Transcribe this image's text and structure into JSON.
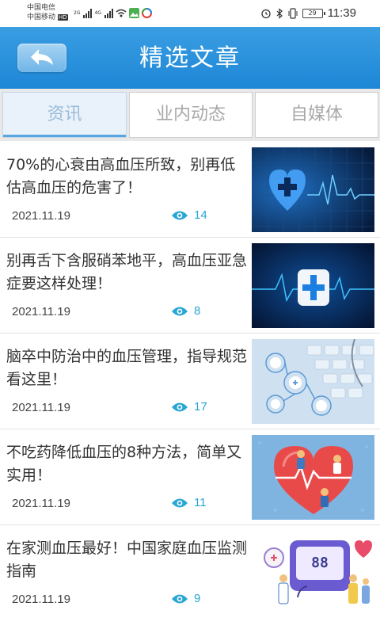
{
  "status_bar": {
    "carrier_line1": "中国电信",
    "carrier_line2": "中国移动",
    "hd_badge": "HD",
    "net_type_1": "2G",
    "net_type_2": "4G",
    "battery": "29",
    "time": "11:39"
  },
  "header": {
    "title": "精选文章",
    "back_icon": "back-arrow-icon"
  },
  "tabs": [
    {
      "label": "资讯",
      "active": true
    },
    {
      "label": "业内动态",
      "active": false
    },
    {
      "label": "自媒体",
      "active": false
    }
  ],
  "articles": [
    {
      "title": "70%的心衰由高血压所致，别再低估高血压的危害了！",
      "date": "2021.11.19",
      "views": "14",
      "image": "heart-ecg-blue"
    },
    {
      "title": "别再舌下含服硝苯地平，高血压亚急症要这样处理！",
      "date": "2021.11.19",
      "views": "8",
      "image": "medical-cross-ecg"
    },
    {
      "title": "脑卒中防治中的血压管理，指导规范看这里！",
      "date": "2021.11.19",
      "views": "17",
      "image": "keyboard-stethoscope"
    },
    {
      "title": "不吃药降低血压的8种方法，简单又实用！",
      "date": "2021.11.19",
      "views": "11",
      "image": "heart-doctors"
    },
    {
      "title": "在家测血压最好！中国家庭血压监测指南",
      "date": "2021.11.19",
      "views": "9",
      "image": "blood-pressure-monitor"
    }
  ],
  "colors": {
    "header_blue": "#1d86d6",
    "view_accent": "#29a6d3"
  }
}
